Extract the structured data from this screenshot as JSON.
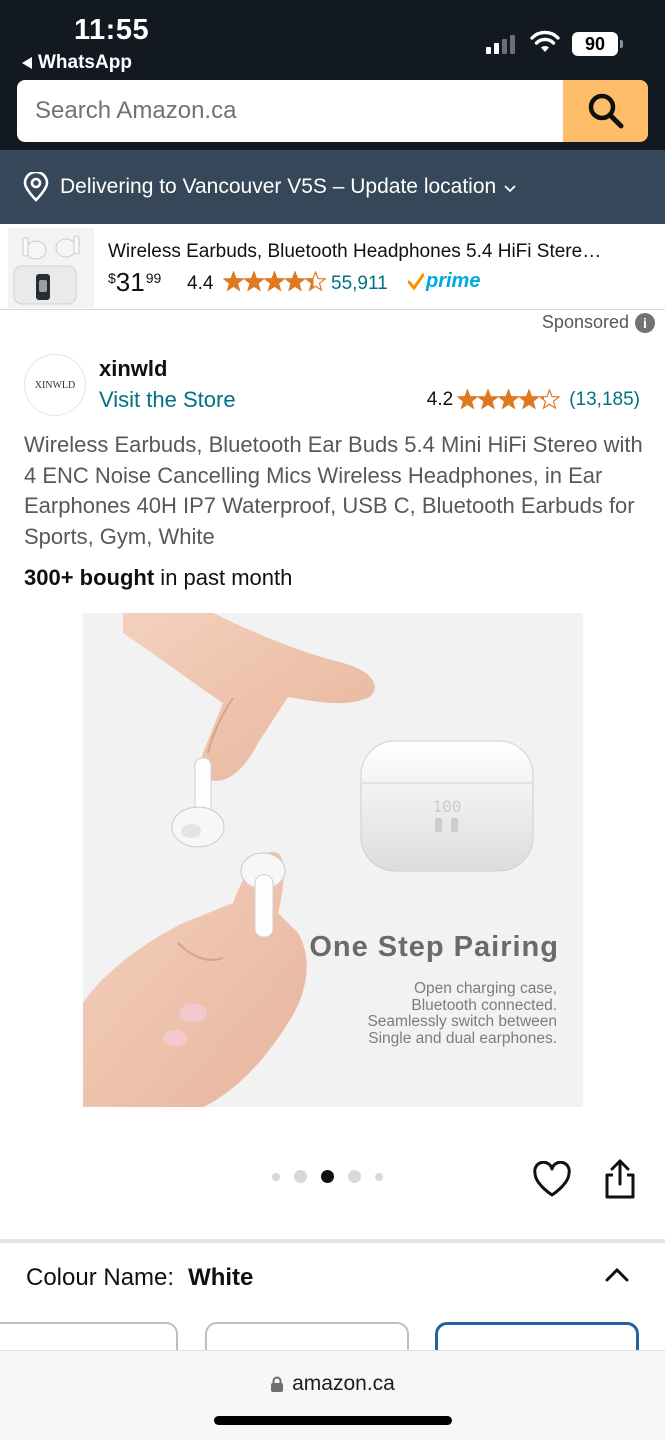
{
  "status_bar": {
    "time": "11:55",
    "back_app": "WhatsApp",
    "battery": "90"
  },
  "search": {
    "placeholder": "Search Amazon.ca",
    "button_icon": "search-icon",
    "accent_color": "#febd69"
  },
  "location": {
    "text": "Delivering to Vancouver V5S – Update location"
  },
  "sticky_product": {
    "title": "Wireless Earbuds, Bluetooth Headphones 5.4 HiFi Stere…",
    "price_symbol": "$",
    "price_whole": "31",
    "price_fraction": "99",
    "rating": "4.4",
    "rating_value": 4.4,
    "review_count": "55,911",
    "prime_label": "prime"
  },
  "sponsored_label": "Sponsored",
  "brand": {
    "logo_text": "XINWLD",
    "name": "xinwld",
    "visit_store": "Visit the Store",
    "rating": "4.2",
    "rating_value": 4.2,
    "review_count": "(13,185)"
  },
  "product": {
    "title": "Wireless Earbuds, Bluetooth Ear Buds 5.4 Mini HiFi Stereo with 4 ENC Noise Cancelling Mics Wireless Headphones, in Ear Earphones 40H IP7 Waterproof, USB C, Bluetooth Earbuds for Sports, Gym, White",
    "bought_bold": "300+ bought",
    "bought_rest": " in past month",
    "image": {
      "case_display": "100",
      "headline": "One Step Pairing",
      "sub_lines": [
        "Open charging case,",
        "Bluetooth connected.",
        "Seamlessly switch between",
        "Single and dual earphones."
      ]
    },
    "carousel_active_index": 2,
    "carousel_count": 5
  },
  "colour": {
    "label": "Colour Name:",
    "value": "White"
  },
  "browser": {
    "url": "amazon.ca"
  },
  "colors": {
    "header_bg": "#131921",
    "location_bg": "#37475a",
    "link": "#007185",
    "star": "#de7921",
    "prime": "#00a8e1",
    "selected_swatch": "#2162a1"
  }
}
